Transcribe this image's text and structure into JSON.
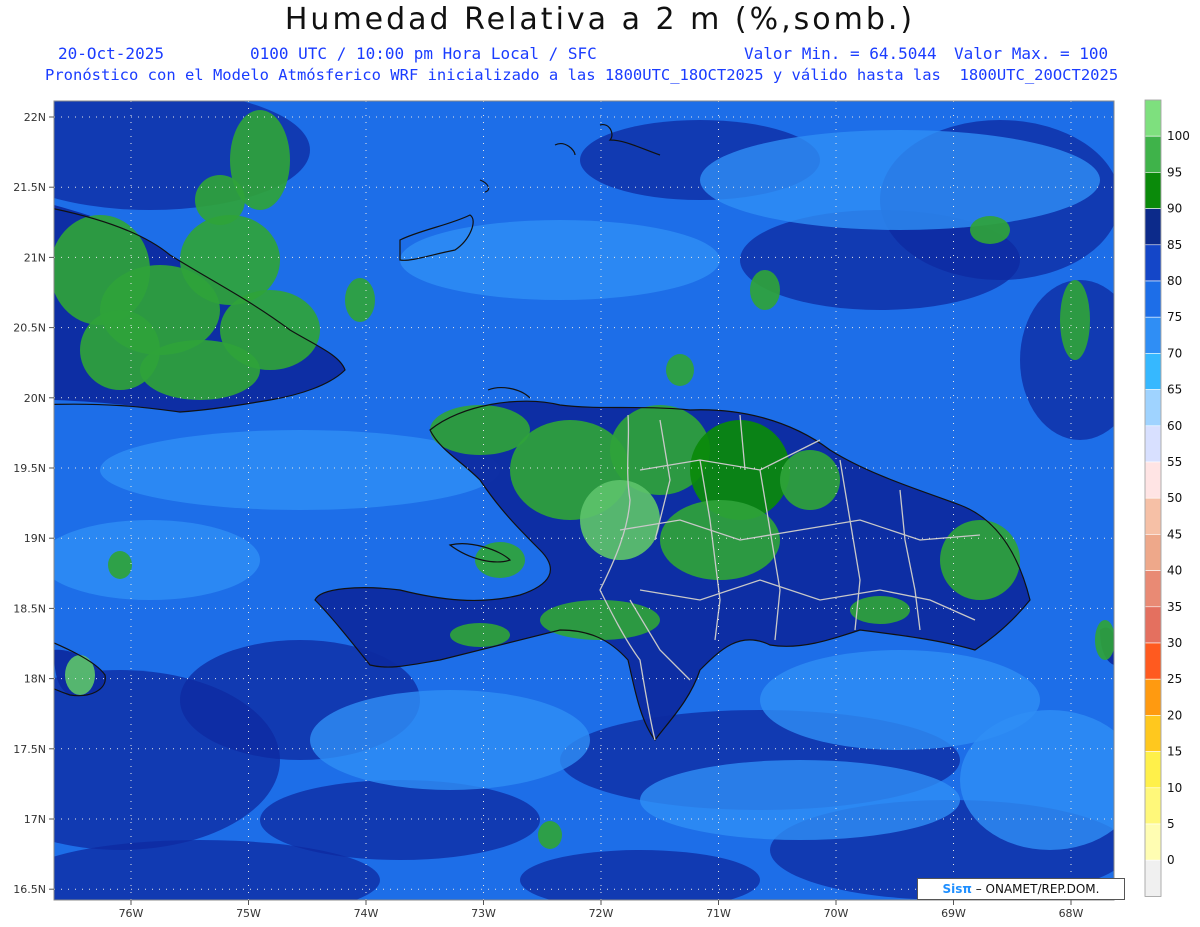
{
  "header": {
    "title": "Humedad Relativa a 2 m (%,somb.)",
    "date": "20-Oct-2025",
    "time": "0100 UTC / 10:00 pm Hora Local / SFC",
    "min": "Valor Min. = 64.5044",
    "max": "Valor Max. = 100",
    "subtitle": "Pronóstico con el Modelo Atmósferico WRF inicializado a las 1800UTC_18OCT2025 y válido hasta las  1800UTC_20OCT2025"
  },
  "map": {
    "lat_labels": [
      "22N",
      "21.5N",
      "21N",
      "20.5N",
      "20N",
      "19.5N",
      "19N",
      "18.5N",
      "18N",
      "17.5N",
      "17N",
      "16.5N"
    ],
    "lon_labels": [
      "76W",
      "75W",
      "74W",
      "73W",
      "72W",
      "71W",
      "70W",
      "69W",
      "68W"
    ],
    "colors": {
      "ocean": "#1547c9",
      "dark": "#0d2aa0",
      "mid": "#1d6ee8",
      "light": "#2f8ef5",
      "green_dark": "#0a8a0a",
      "green": "#2fa33a",
      "green_light": "#5cc26a"
    }
  },
  "colorbar": {
    "labels": [
      "100",
      "95",
      "90",
      "85",
      "80",
      "75",
      "70",
      "65",
      "60",
      "55",
      "50",
      "45",
      "40",
      "35",
      "30",
      "25",
      "20",
      "15",
      "10",
      "5",
      "0"
    ],
    "colors": [
      "#7ee07e",
      "#3fb34a",
      "#0a8a0a",
      "#0c2a8a",
      "#1446c8",
      "#1d6ee8",
      "#2f8ef5",
      "#36b8ff",
      "#9fd3ff",
      "#d8e0ff",
      "#ffe4e4",
      "#f6c0a6",
      "#eea88a",
      "#e98a74",
      "#e4705f",
      "#ff5a1f",
      "#ff9a10",
      "#ffc81e",
      "#fff04a",
      "#fff87a",
      "#fffdb2",
      "#f0f0f0"
    ]
  },
  "credit": {
    "brand": "Sisπ",
    "text": " – ONAMET/REP.DOM."
  }
}
